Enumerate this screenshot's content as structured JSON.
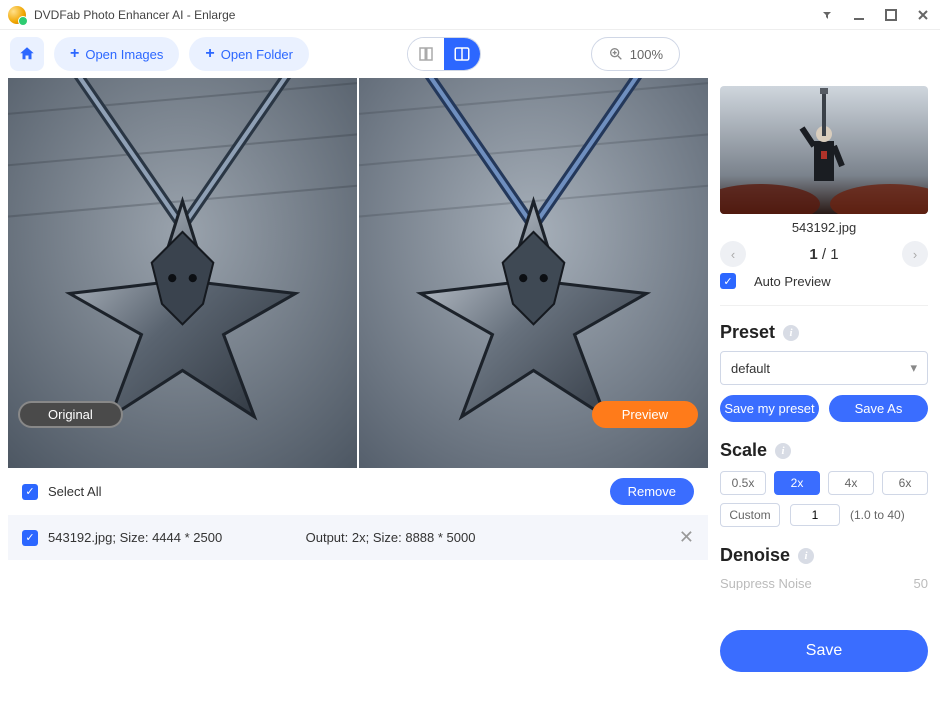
{
  "titlebar": {
    "title": "DVDFab Photo Enhancer AI - Enlarge"
  },
  "toolbar": {
    "open_images": "Open Images",
    "open_folder": "Open Folder",
    "zoom": "100%"
  },
  "preview": {
    "original_label": "Original",
    "preview_label": "Preview"
  },
  "filelist": {
    "select_all": "Select All",
    "remove": "Remove",
    "row": {
      "name_size": "543192.jpg; Size: 4444 * 2500",
      "output": "Output: 2x; Size: 8888 * 5000"
    }
  },
  "sidebar": {
    "thumb_name": "543192.jpg",
    "page": {
      "cur": "1",
      "sep": " / ",
      "total": "1"
    },
    "auto_preview": "Auto Preview",
    "preset": {
      "title": "Preset",
      "value": "default",
      "save_my": "Save my preset",
      "save_as": "Save As"
    },
    "scale": {
      "title": "Scale",
      "opts": [
        "0.5x",
        "2x",
        "4x",
        "6x"
      ],
      "custom": "Custom",
      "custom_val": "1",
      "range": "(1.0 to 40)"
    },
    "denoise": {
      "title": "Denoise",
      "sub_label": "Suppress Noise",
      "sub_val": "50"
    },
    "save": "Save"
  }
}
